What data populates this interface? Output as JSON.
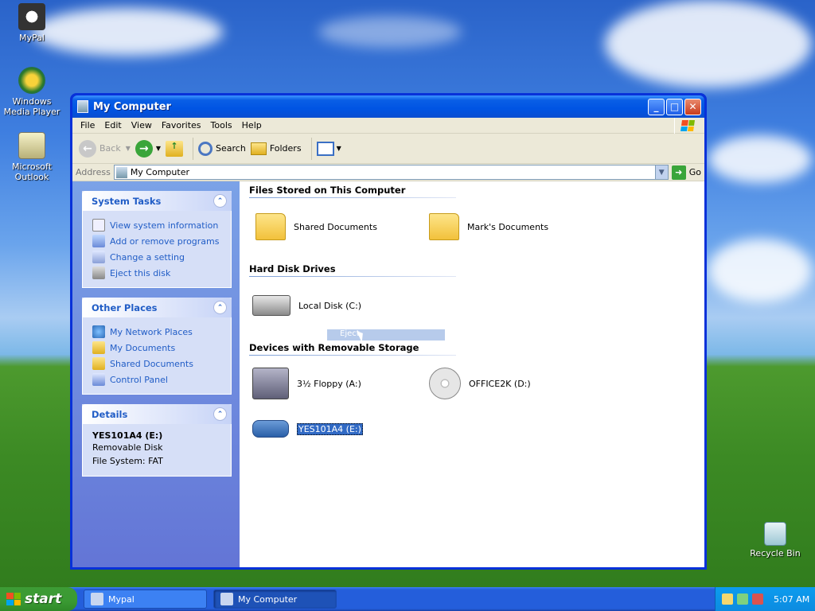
{
  "desktop": {
    "icons": [
      {
        "label": "MyPal"
      },
      {
        "label": "Windows Media Player"
      },
      {
        "label": "Microsoft Outlook"
      },
      {
        "label": "Recycle Bin"
      }
    ]
  },
  "window": {
    "title": "My Computer",
    "menu": [
      "File",
      "Edit",
      "View",
      "Favorites",
      "Tools",
      "Help"
    ],
    "toolbar": {
      "back": "Back",
      "search": "Search",
      "folders": "Folders"
    },
    "address": {
      "label": "Address",
      "value": "My Computer",
      "go": "Go"
    }
  },
  "sidebar": {
    "system_tasks": {
      "title": "System Tasks",
      "items": [
        "View system information",
        "Add or remove programs",
        "Change a setting",
        "Eject this disk"
      ]
    },
    "other_places": {
      "title": "Other Places",
      "items": [
        "My Network Places",
        "My Documents",
        "Shared Documents",
        "Control Panel"
      ]
    },
    "details": {
      "title": "Details",
      "name": "YES101A4 (E:)",
      "type": "Removable Disk",
      "filesystem": "File System: FAT"
    }
  },
  "main": {
    "groups": [
      {
        "title": "Files Stored on This Computer"
      },
      {
        "title": "Hard Disk Drives"
      },
      {
        "title": "Devices with Removable Storage"
      }
    ],
    "items": {
      "shared_documents": "Shared Documents",
      "marks_documents": "Mark's Documents",
      "local_disk": "Local Disk (C:)",
      "floppy": "3½ Floppy (A:)",
      "cd": "OFFICE2K (D:)",
      "usb": "YES101A4 (E:)"
    },
    "drag_ghost": "Eject"
  },
  "taskbar": {
    "start": "start",
    "tasks": [
      "Mypal",
      "My Computer"
    ],
    "clock": "5:07 AM"
  }
}
